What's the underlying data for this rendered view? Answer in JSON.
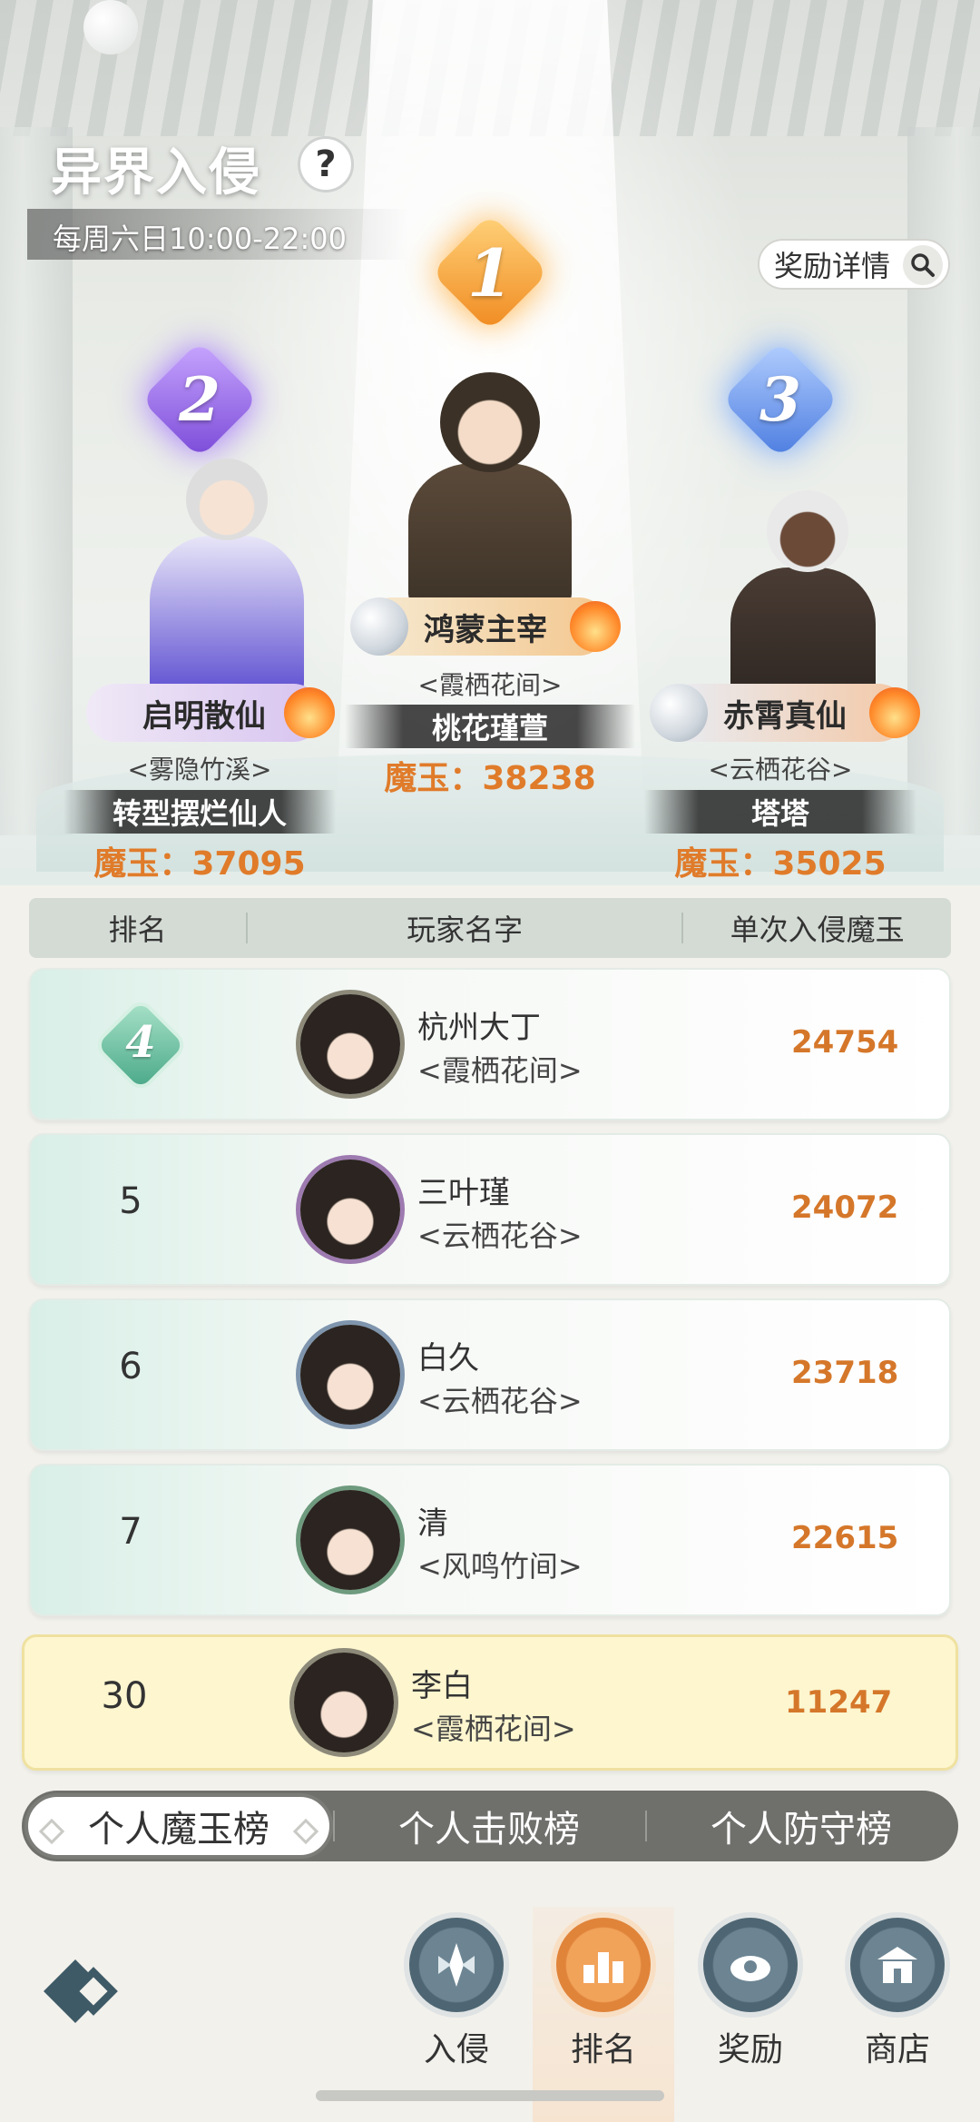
{
  "header": {
    "title": "异界入侵",
    "help_icon": "question-icon",
    "schedule": "每周六日10:00-22:00",
    "reward_detail_label": "奖励详情"
  },
  "podium": [
    {
      "rank": "1",
      "name": "鸿蒙主宰",
      "guild": "<霞栖花间>",
      "title": "桃花瑾萱",
      "score": "魔玉：38238",
      "accent": "#f08a20"
    },
    {
      "rank": "2",
      "name": "启明散仙",
      "guild": "<雾隐竹溪>",
      "title": "转型摆烂仙人",
      "score": "魔玉：37095",
      "accent": "#7a4ad8"
    },
    {
      "rank": "3",
      "name": "赤霄真仙",
      "guild": "<云栖花谷>",
      "title": "塔塔",
      "score": "魔玉：35025",
      "accent": "#4b7ce0"
    }
  ],
  "table": {
    "headers": [
      "排名",
      "玩家名字",
      "单次入侵魔玉"
    ],
    "rows": [
      {
        "rank": "4",
        "name": "杭州大丁",
        "guild": "<霞栖花间>",
        "score": "24754"
      },
      {
        "rank": "5",
        "name": "三叶瑾",
        "guild": "<云栖花谷>",
        "score": "24072"
      },
      {
        "rank": "6",
        "name": "白久",
        "guild": "<云栖花谷>",
        "score": "23718"
      },
      {
        "rank": "7",
        "name": "清",
        "guild": "<风鸣竹间>",
        "score": "22615"
      }
    ],
    "my_row": {
      "rank": "30",
      "name": "李白",
      "guild": "<霞栖花间>",
      "score": "11247"
    }
  },
  "tabs": [
    "个人魔玉榜",
    "个人击败榜",
    "个人防守榜"
  ],
  "nav": [
    {
      "label": "入侵",
      "icon": "invade-icon"
    },
    {
      "label": "排名",
      "icon": "ranking-icon",
      "active": true
    },
    {
      "label": "奖励",
      "icon": "reward-icon"
    },
    {
      "label": "商店",
      "icon": "shop-icon"
    }
  ],
  "colors": {
    "score": "#d5772a",
    "active_nav": "#e0843a",
    "nav": "#4e6673"
  }
}
